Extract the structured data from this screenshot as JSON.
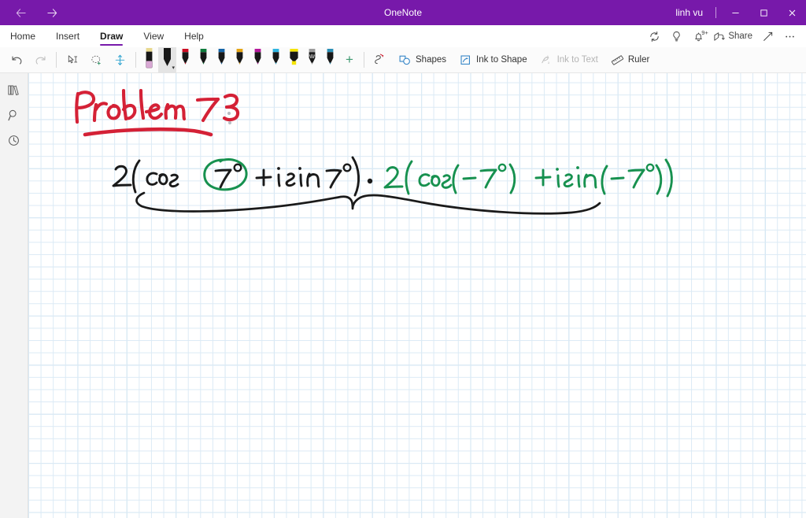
{
  "window": {
    "app_title": "OneNote",
    "user": "linh vu",
    "back_icon": "back-arrow-icon",
    "forward_icon": "forward-arrow-icon",
    "minimize_label": "–",
    "maximize_label": "❐",
    "close_label": "✕"
  },
  "ribbon": {
    "tabs": [
      {
        "label": "Home",
        "active": false
      },
      {
        "label": "Insert",
        "active": false
      },
      {
        "label": "Draw",
        "active": true
      },
      {
        "label": "View",
        "active": false
      },
      {
        "label": "Help",
        "active": false
      }
    ],
    "right_actions": [
      {
        "name": "sync-icon",
        "label": ""
      },
      {
        "name": "lightbulb-icon",
        "label": ""
      },
      {
        "name": "notifications-bell-icon",
        "label": "",
        "badge": "9+"
      },
      {
        "name": "share-icon",
        "label": "Share"
      },
      {
        "name": "expand-icon",
        "label": ""
      },
      {
        "name": "more-options-icon",
        "label": ""
      }
    ]
  },
  "toolbar": {
    "undo_label": "Undo",
    "redo_label": "Redo",
    "lasso_text_label": "Lasso Select",
    "lasso_select_label": "Lasso Select",
    "insert_space_label": "Insert Space",
    "eraser_label": "Eraser",
    "pens": [
      {
        "name": "eraser",
        "color": "#d9a8d4",
        "type": "eraser",
        "selected": false
      },
      {
        "name": "pen-black",
        "color": "#161616",
        "type": "pen",
        "selected": true
      },
      {
        "name": "pen-red",
        "color": "#cc0c22",
        "type": "pen",
        "selected": false
      },
      {
        "name": "pen-green",
        "color": "#0f7b3c",
        "type": "pen",
        "selected": false
      },
      {
        "name": "pen-blue",
        "color": "#1565a8",
        "type": "pen",
        "selected": false
      },
      {
        "name": "pen-gold",
        "color": "#e5a516",
        "type": "pen",
        "selected": false
      },
      {
        "name": "pen-magenta",
        "color": "#b5199b",
        "type": "pen",
        "selected": false
      },
      {
        "name": "pen-cyan",
        "color": "#2fb4e0",
        "type": "pen",
        "selected": false
      },
      {
        "name": "highlighter-yellow",
        "color": "#f5e400",
        "type": "highlighter",
        "selected": false
      },
      {
        "name": "pencil-grey",
        "color": "#9b9b9b",
        "type": "pencil",
        "selected": false
      },
      {
        "name": "pen-teal",
        "color": "#2b8fb5",
        "type": "pen",
        "selected": false
      }
    ],
    "add_pen_label": "+",
    "ink_to_math_label": "",
    "shapes_label": "Shapes",
    "ink_to_shape_label": "Ink to Shape",
    "ink_to_text_label": "Ink to Text",
    "ink_to_text_disabled": true,
    "ruler_label": "Ruler"
  },
  "sidebar": {
    "items": [
      {
        "name": "notebooks-icon",
        "label": "Notebooks"
      },
      {
        "name": "search-icon",
        "label": "Search"
      },
      {
        "name": "recent-notes-icon",
        "label": "Recent Notes"
      }
    ]
  },
  "canvas": {
    "page_grid": "small-grid",
    "ink": {
      "heading_text": "Problem 73 :",
      "heading_color": "#d42136",
      "heading_underline_color": "#d42136",
      "expression_left_text": "2 (cos(7°) + i sin 7°)",
      "expression_left_color": "#1a1a1a",
      "multiply_dot": "·",
      "circled_value": "7°",
      "circle_color": "#17914f",
      "expression_right_text": "2 (cos(-7°) + i sin(-7°))",
      "expression_right_color": "#17914f",
      "brace_color": "#1a1a1a"
    }
  },
  "colors": {
    "titlebar": "#7719aa",
    "accent": "#7719aa",
    "toolbar_bg": "#fbfbfb",
    "sidebar_bg": "#f3f3f3",
    "grid_minor": "#dbeaf5",
    "grid_major": "#bcd9ec"
  }
}
